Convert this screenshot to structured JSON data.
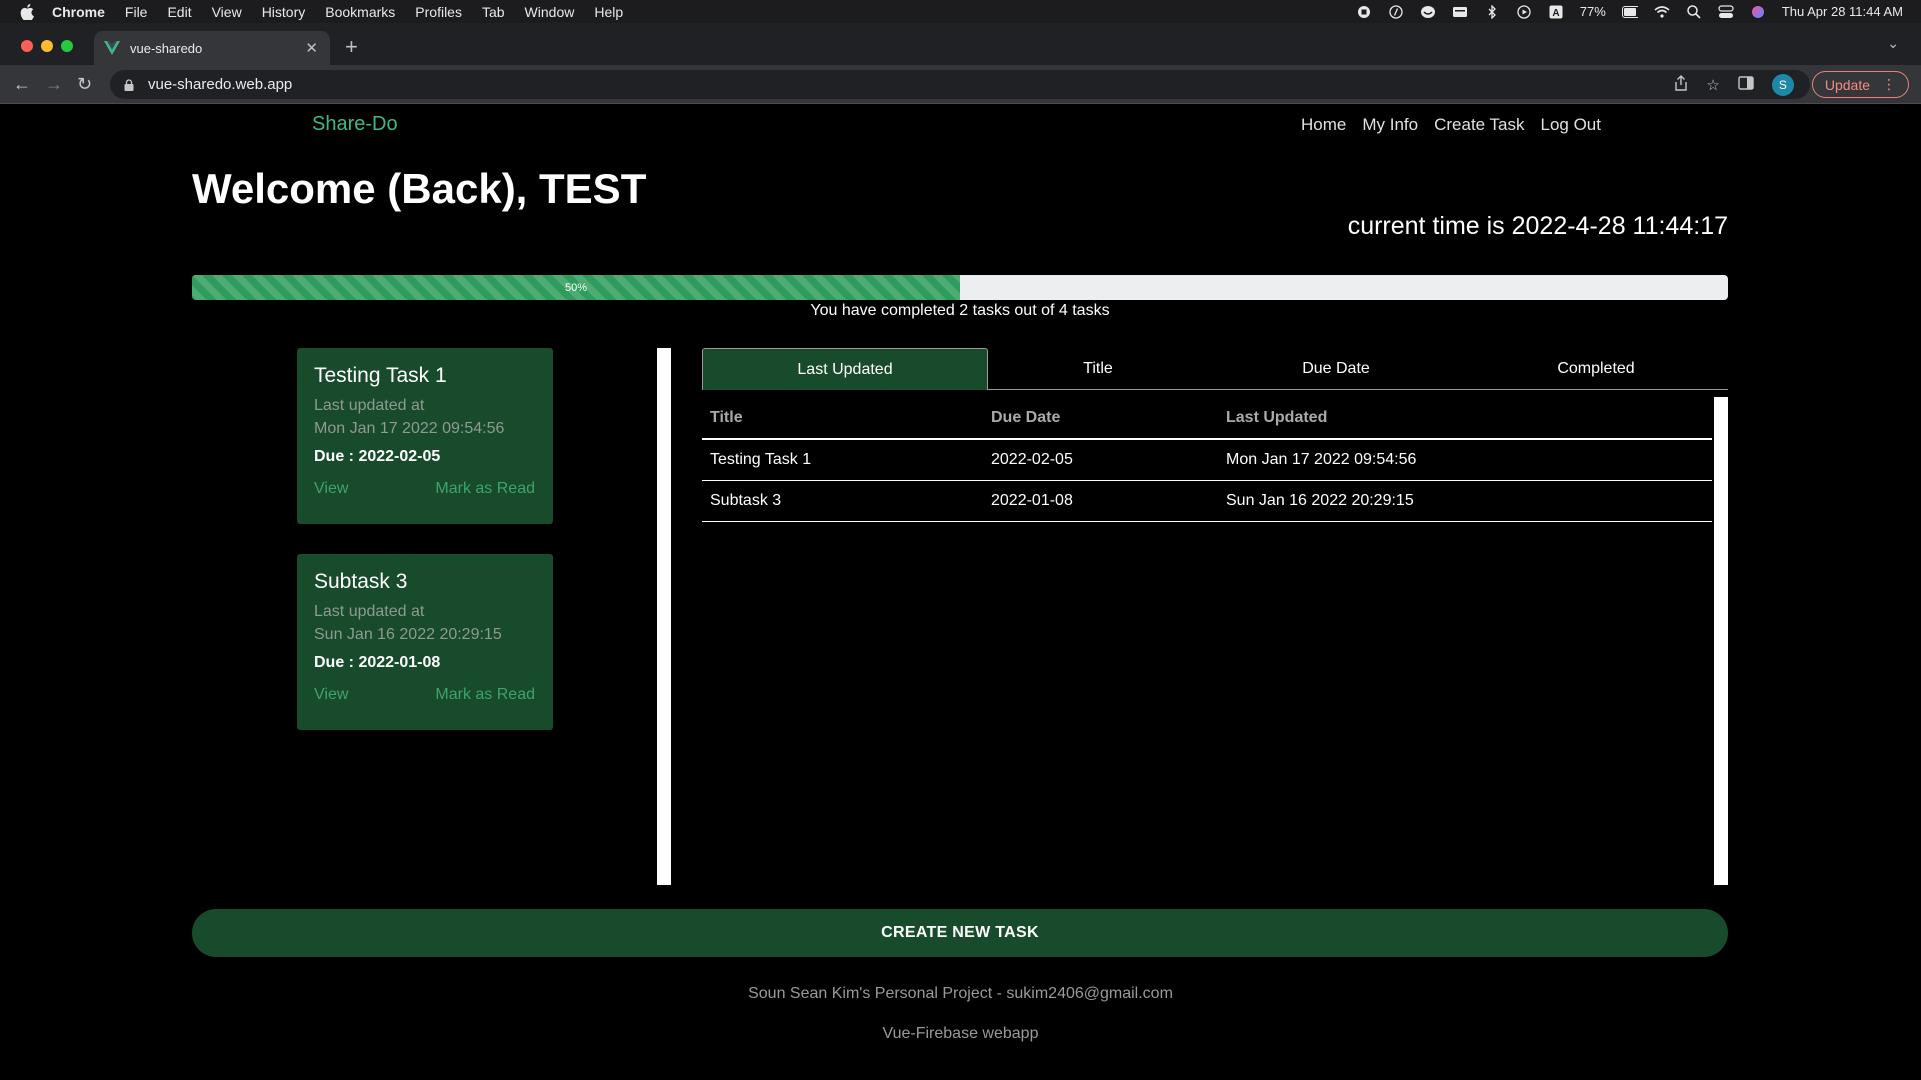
{
  "menubar": {
    "app": "Chrome",
    "items": [
      "File",
      "Edit",
      "View",
      "History",
      "Bookmarks",
      "Profiles",
      "Tab",
      "Window",
      "Help"
    ],
    "battery": "77%",
    "datetime": "Thu Apr 28  11:44 AM"
  },
  "browser": {
    "tab_title": "vue-sharedo",
    "url": "vue-sharedo.web.app",
    "profile_initial": "S",
    "update_label": "Update"
  },
  "site": {
    "brand": "Share-Do",
    "nav": [
      "Home",
      "My Info",
      "Create Task",
      "Log Out"
    ]
  },
  "header": {
    "welcome": "Welcome (Back), TEST",
    "clock": "current time is 2022-4-28 11:44:17"
  },
  "progress": {
    "percent": 50,
    "label": "50%",
    "summary": "You have completed 2 tasks out of 4 tasks"
  },
  "cards": [
    {
      "title": "Testing Task 1",
      "updated_label": "Last updated at",
      "updated": "Mon Jan 17 2022 09:54:56",
      "due": "Due : 2022-02-05",
      "view": "View",
      "mark": "Mark as Read"
    },
    {
      "title": "Subtask 3",
      "updated_label": "Last updated at",
      "updated": "Sun Jan 16 2022 20:29:15",
      "due": "Due : 2022-01-08",
      "view": "View",
      "mark": "Mark as Read"
    }
  ],
  "sort_tabs": [
    "Last Updated",
    "Title",
    "Due Date",
    "Completed"
  ],
  "table": {
    "headers": [
      "Title",
      "Due Date",
      "Last Updated"
    ],
    "rows": [
      [
        "Testing Task 1",
        "2022-02-05",
        "Mon Jan 17 2022 09:54:56"
      ],
      [
        "Subtask 3",
        "2022-01-08",
        "Sun Jan 16 2022 20:29:15"
      ]
    ]
  },
  "create_button": "CREATE NEW TASK",
  "footer": {
    "line1": "Soun Sean Kim's Personal Project - sukim2406@gmail.com",
    "line2": "Vue-Firebase webapp"
  },
  "colors": {
    "accent": "#41b883",
    "card_bg": "#184a2c",
    "progress": "#2e9c5a"
  }
}
